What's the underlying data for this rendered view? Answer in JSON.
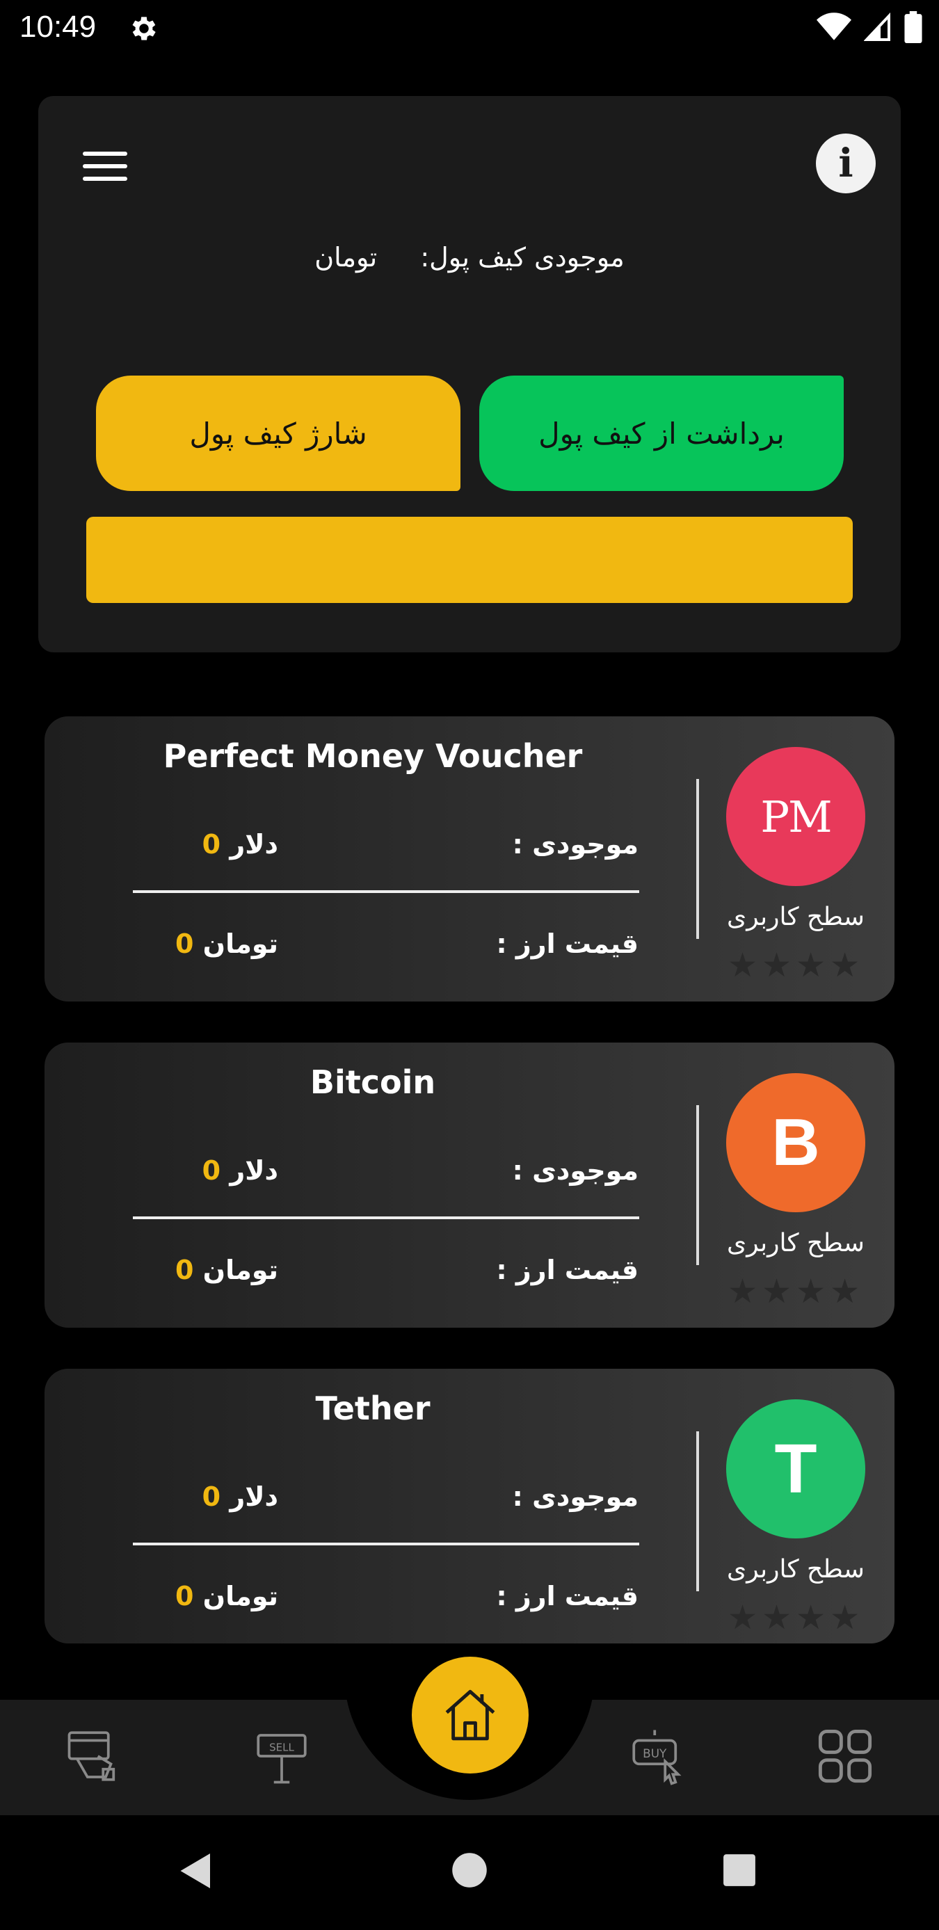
{
  "status_bar": {
    "time": "10:49"
  },
  "wallet": {
    "balance_label": "موجودی کیف پول:",
    "balance_unit": "تومان",
    "charge_button": "شارژ کیف پول",
    "withdraw_button": "برداشت از کیف پول"
  },
  "currencies": [
    {
      "title": "Perfect Money Voucher",
      "balance_label": "موجودی :",
      "balance_value": "0",
      "balance_unit": "دلار",
      "price_label": "قیمت ارز :",
      "price_value": "0",
      "price_unit": "تومان",
      "level_label": "سطح کاربری",
      "logo_text": "PM",
      "color": "#e8395a"
    },
    {
      "title": "Bitcoin",
      "balance_label": "موجودی :",
      "balance_value": "0",
      "balance_unit": "دلار",
      "price_label": "قیمت ارز :",
      "price_value": "0",
      "price_unit": "تومان",
      "level_label": "سطح کاربری",
      "logo_text": "B",
      "color": "#ef6a2b"
    },
    {
      "title": "Tether",
      "balance_label": "موجودی :",
      "balance_value": "0",
      "balance_unit": "دلار",
      "price_label": "قیمت ارز :",
      "price_value": "0",
      "price_unit": "تومان",
      "level_label": "سطح کاربری",
      "logo_text": "T",
      "color": "#21c06b"
    }
  ],
  "bottom_nav": {
    "items": [
      "card-payment-icon",
      "sell-sign-icon",
      "home-icon",
      "buy-click-icon",
      "grid-menu-icon"
    ],
    "active": "home-icon"
  },
  "colors": {
    "accent": "#f1b811",
    "green": "#07c45a",
    "card": "#1b1b1b"
  }
}
